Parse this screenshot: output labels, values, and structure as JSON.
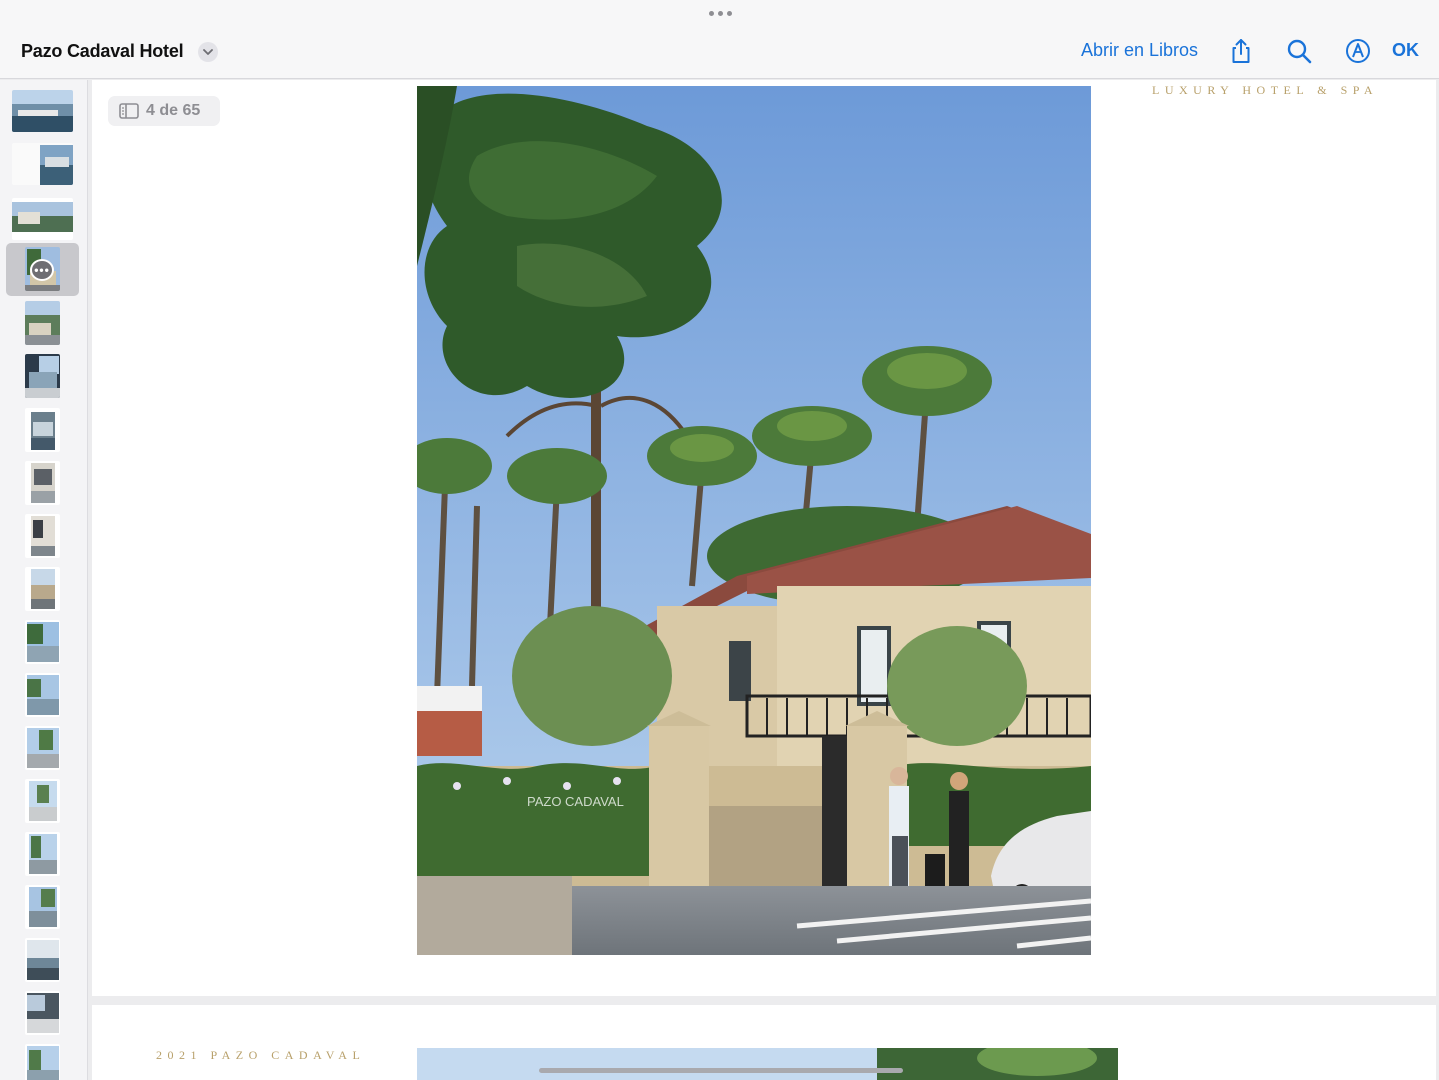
{
  "toolbar": {
    "title": "Pazo Cadaval Hotel",
    "open_in_books": "Abrir en Libros",
    "ok": "OK",
    "icons": [
      "more-dots-icon",
      "chevron-down-icon",
      "share-icon",
      "search-icon",
      "markup-icon"
    ]
  },
  "viewer": {
    "page_indicator": "4 de 65",
    "page4_brand": "LUXURY HOTEL & SPA",
    "page5_brand": "2021 PAZO CADAVAL",
    "watermark": "PAZO CADAVAL",
    "current_page": 4,
    "total_pages": 65
  },
  "sidebar": {
    "thumbnails": [
      "1",
      "2",
      "3",
      "4",
      "5",
      "6",
      "7",
      "8",
      "9",
      "10",
      "11",
      "12",
      "13",
      "14",
      "15",
      "16",
      "17",
      "18",
      "19"
    ],
    "selected_index": 3,
    "more_label": "•••"
  },
  "colors": {
    "accent": "#1a73d9",
    "gold": "#b8a06a"
  }
}
